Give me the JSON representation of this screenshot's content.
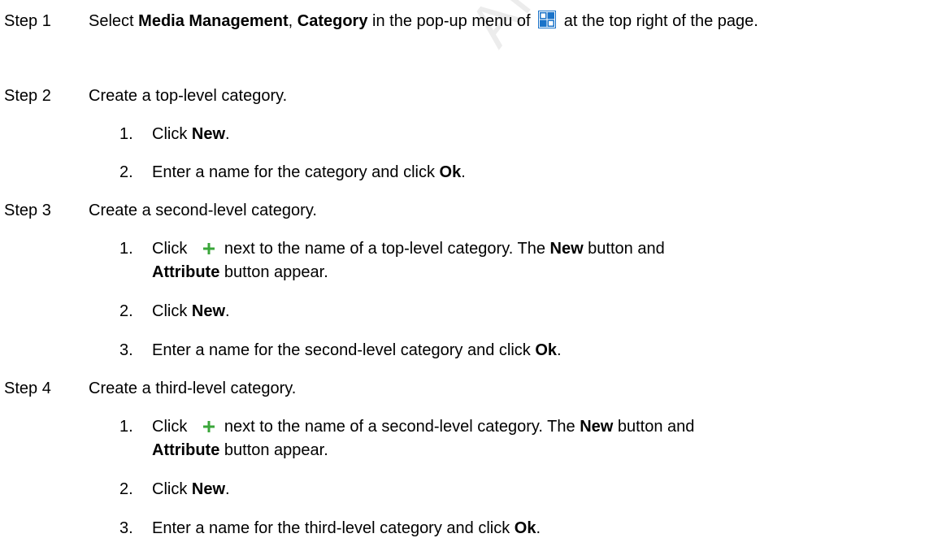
{
  "watermark": "AN NOVASTAR TECH",
  "colors": {
    "grid_icon": "#1a73c9",
    "plus_icon": "#3aa63a"
  },
  "icons": {
    "menu": "grid-icon",
    "add": "plus-icon"
  },
  "steps": [
    {
      "label": "Step 1",
      "text": {
        "a": "Select ",
        "b1": "Media Management",
        "c": ", ",
        "b2": "Category",
        "d": " in the pop-up menu of ",
        "e": " at the top right of the page."
      }
    },
    {
      "label": "Step 2",
      "text": "Create a top-level category.",
      "subs": [
        {
          "num": "1.",
          "a": "Click ",
          "b": "New",
          "c": "."
        },
        {
          "num": "2.",
          "a": "Enter a name for the category and click ",
          "b": "Ok",
          "c": "."
        }
      ]
    },
    {
      "label": "Step 3",
      "text": "Create a second-level category.",
      "subs": [
        {
          "num": "1.",
          "a": "Click ",
          "b": "next to the name of a top-level category. The ",
          "c": "New",
          "d": " button and ",
          "e": "Attribute",
          "f": " button appear."
        },
        {
          "num": "2.",
          "a": "Click ",
          "b": "New",
          "c": "."
        },
        {
          "num": "3.",
          "a": "Enter a name for the second-level category and click ",
          "b": "Ok",
          "c": "."
        }
      ]
    },
    {
      "label": "Step 4",
      "text": "Create a third-level category.",
      "subs": [
        {
          "num": "1.",
          "a": "Click ",
          "b": "next to the name of a second-level category. The ",
          "c": "New",
          "d": " button and ",
          "e": "Attribute",
          "f": " button appear."
        },
        {
          "num": "2.",
          "a": "Click ",
          "b": "New",
          "c": "."
        },
        {
          "num": "3.",
          "a": "Enter a name for the third-level category and click ",
          "b": "Ok",
          "c": "."
        }
      ]
    }
  ]
}
